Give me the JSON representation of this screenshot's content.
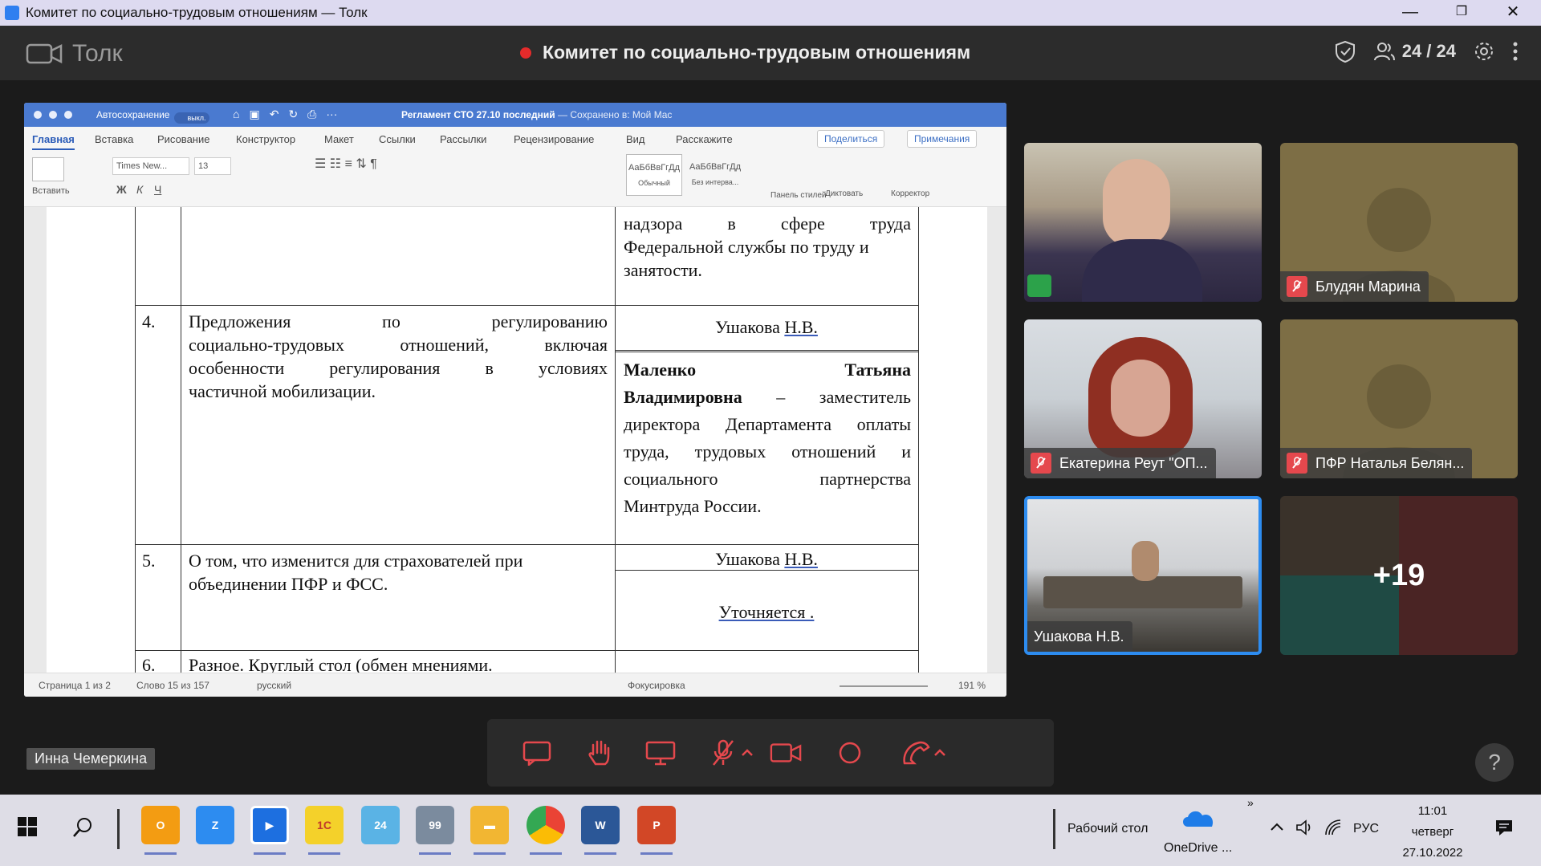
{
  "window": {
    "title": "Комитет по социально-трудовым отношениям — Толк",
    "controls": {
      "minimize": "—",
      "maximize": "❐",
      "close": "✕"
    }
  },
  "app": {
    "logo_text": "Толк",
    "meeting_title": "Комитет по социально-трудовым отношениям",
    "participants_count": "24 / 24"
  },
  "word": {
    "autosave_label": "Автосохранение",
    "autosave_state": "выкл.",
    "doc_title": "Регламент СТО 27.10 последний",
    "doc_saved": "— Сохранено в: Мой Mac",
    "tabs": [
      "Главная",
      "Вставка",
      "Рисование",
      "Конструктор",
      "Макет",
      "Ссылки",
      "Рассылки",
      "Рецензирование",
      "Вид",
      "Расскажите"
    ],
    "share_btn": "Поделиться",
    "comments_btn": "Примечания",
    "ribbon": {
      "paste": "Вставить",
      "font": "Times New...",
      "size": "13",
      "style1_sample": "АаБбВвГгДд",
      "style1": "Обычный",
      "style2_sample": "АаБбВвГгДд",
      "style2": "Без интерва...",
      "styles_pane": "Панель стилей",
      "dictate": "Диктовать",
      "editor": "Корректор"
    },
    "status": {
      "page": "Страница 1 из 2",
      "words": "Слово 15 из 157",
      "lang": "русский",
      "focus": "Фокусировка",
      "zoom": "191 %"
    }
  },
  "doc": {
    "row3_right": [
      "надзора",
      "в",
      "сфере",
      "труда",
      "Федеральной службы по труду и",
      "занятости."
    ],
    "row4": {
      "num": "4.",
      "text": [
        "Предложения по регулированию",
        "социально-трудовых отношений, включая",
        "особенности регулирования в условиях",
        "частичной мобилизации."
      ],
      "speaker1_prefix": "Ушакова ",
      "speaker1_init": "Н.В.",
      "speaker2_name1": "Маленко",
      "speaker2_name2": "Татьяна",
      "speaker2_name3": "Владимировна",
      "speaker2_role": "– заместитель",
      "speaker2_lines": [
        "директора Департамента оплаты",
        "труда, трудовых отношений и",
        "социального партнерства",
        "Минтруда России."
      ]
    },
    "row5": {
      "num": "5.",
      "text": [
        "О том, что изменится для страхователей при",
        "объединении ПФР и ФСС."
      ],
      "speaker1_prefix": "Ушакова ",
      "speaker1_init": "Н.В.",
      "speaker2": "Уточняется ."
    },
    "row6": {
      "num": "6.",
      "text": "Разное. Круглый стол (обмен мнениями."
    }
  },
  "presenter_name": "Инна Чемеркина",
  "tiles": [
    {
      "name": ""
    },
    {
      "name": "Блудян Марина"
    },
    {
      "name": "Екатерина Реут \"ОП..."
    },
    {
      "name": "ПФР Наталья Белян..."
    },
    {
      "name": "Ушакова Н.В."
    },
    {
      "overflow": "+19"
    }
  ],
  "controls": [
    "chat",
    "raise-hand",
    "screen-share",
    "mic",
    "camera",
    "record",
    "hangup"
  ],
  "help": "?",
  "taskbar": {
    "desktop": "Рабочий стол",
    "onedrive": "OneDrive ...",
    "lang": "РУС",
    "time": "11:01",
    "day": "четверг",
    "date": "27.10.2022",
    "overflow": "»"
  },
  "colors": {
    "accent": "#2d8cf0",
    "placeholder": "#7d6e45",
    "mic_off": "#e5484d",
    "rec": "#e52b2b"
  }
}
